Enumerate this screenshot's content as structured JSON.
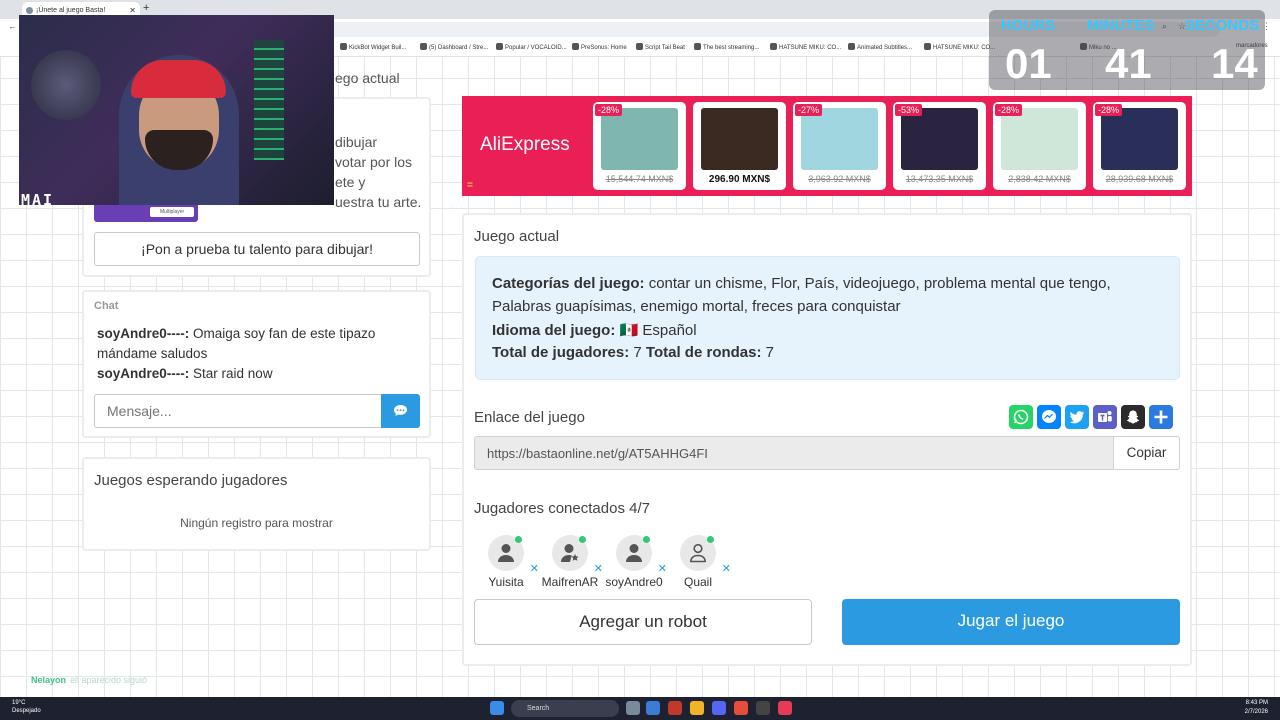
{
  "browser": {
    "tab_title": "¡Únete al juego Basta!",
    "new_tab": "+",
    "bookmarks": [
      "KickBot Widget Buil...",
      "(5) Dashboard / Stre...",
      "Popular / VOCALOID...",
      "PreSonus: Home",
      "Script Tail Beat",
      "The best streaming...",
      "HATSUNE MIKU: CO...",
      "Animated Subtitles...",
      "HATSUNE MIKU: CO...",
      "Miku no ...",
      "marcadores"
    ]
  },
  "stream": {
    "webcam_tag": "MAI",
    "timer": {
      "hours_label": "HOURS",
      "minutes_label": "MINUTES",
      "seconds_label": "SECONDS",
      "hours": "01",
      "minutes": "41",
      "seconds": "14"
    }
  },
  "left": {
    "partial_heading": "ego actual",
    "partial_lines": [
      "dibujar",
      "votar por los",
      "ete y",
      "uestra tu arte."
    ],
    "badge_label": "Multiplayer",
    "draw_button": "¡Pon a prueba tu talento para dibujar!",
    "chat": {
      "title": "Chat",
      "messages": [
        {
          "user": "soyAndre0----:",
          "text": "Omaiga soy fan de este tipazo"
        },
        {
          "user": "",
          "text": "mándame saludos"
        },
        {
          "user": "soyAndre0----:",
          "text": "Star raid now"
        }
      ],
      "input_placeholder": "Mensaje..."
    },
    "waiting": {
      "title": "Juegos esperando jugadores",
      "empty": "Ningún registro para mostrar"
    }
  },
  "ad": {
    "logo": "AliExpress",
    "equals": "=",
    "items": [
      {
        "discount": "-28%",
        "price": "15,544.74 MXN$",
        "struck": true,
        "color": "#7fb7b0"
      },
      {
        "discount": "",
        "price": "296.90 MXN$",
        "struck": false,
        "color": "#3a2a22"
      },
      {
        "discount": "-27%",
        "price": "3,963.92 MXN$",
        "struck": true,
        "color": "#9fd6e0"
      },
      {
        "discount": "-53%",
        "price": "13,473.35 MXN$",
        "struck": true,
        "color": "#2a2440"
      },
      {
        "discount": "-28%",
        "price": "2,838.42 MXN$",
        "struck": true,
        "color": "#cfe7d8"
      },
      {
        "discount": "-28%",
        "price": "28,939.68 MXN$",
        "struck": true,
        "color": "#2a2f5a"
      }
    ]
  },
  "game": {
    "current_title": "Juego actual",
    "categories_label": "Categorías del juego:",
    "categories_text": "contar un chisme, Flor, País, videojuego, problema mental que tengo,",
    "categories_text2": "Palabras guapísimas, enemigo mortal, freces para conquistar",
    "language_label": "Idioma del juego:",
    "language_flag": "🇲🇽",
    "language_value": "Español",
    "players_label": "Total de jugadores:",
    "players_value": "7",
    "rounds_label": "Total de rondas:",
    "rounds_value": "7",
    "link_title": "Enlace del juego",
    "link_value": "https://bastaonline.net/g/AT5AHHG4FI",
    "copy_label": "Copiar",
    "connected_title": "Jugadores conectados 4/7",
    "players": [
      "Yuisita",
      "MaifrenAR",
      "soyAndre0",
      "Quail"
    ],
    "robot_button": "Agregar un robot",
    "play_button": "Jugar el juego",
    "share_colors": [
      "#25d366",
      "#0084ff",
      "#1da1f2",
      "#5b5fc7",
      "#2b2b2b",
      "#2b7ae0"
    ]
  },
  "footer": {
    "user": "Nelayon",
    "user_note": "ell aparecido siguió"
  },
  "taskbar": {
    "temp": "19°C",
    "weather": "Despejado",
    "search": "Search",
    "time": "8:43 PM",
    "date": "2/7/2026"
  }
}
